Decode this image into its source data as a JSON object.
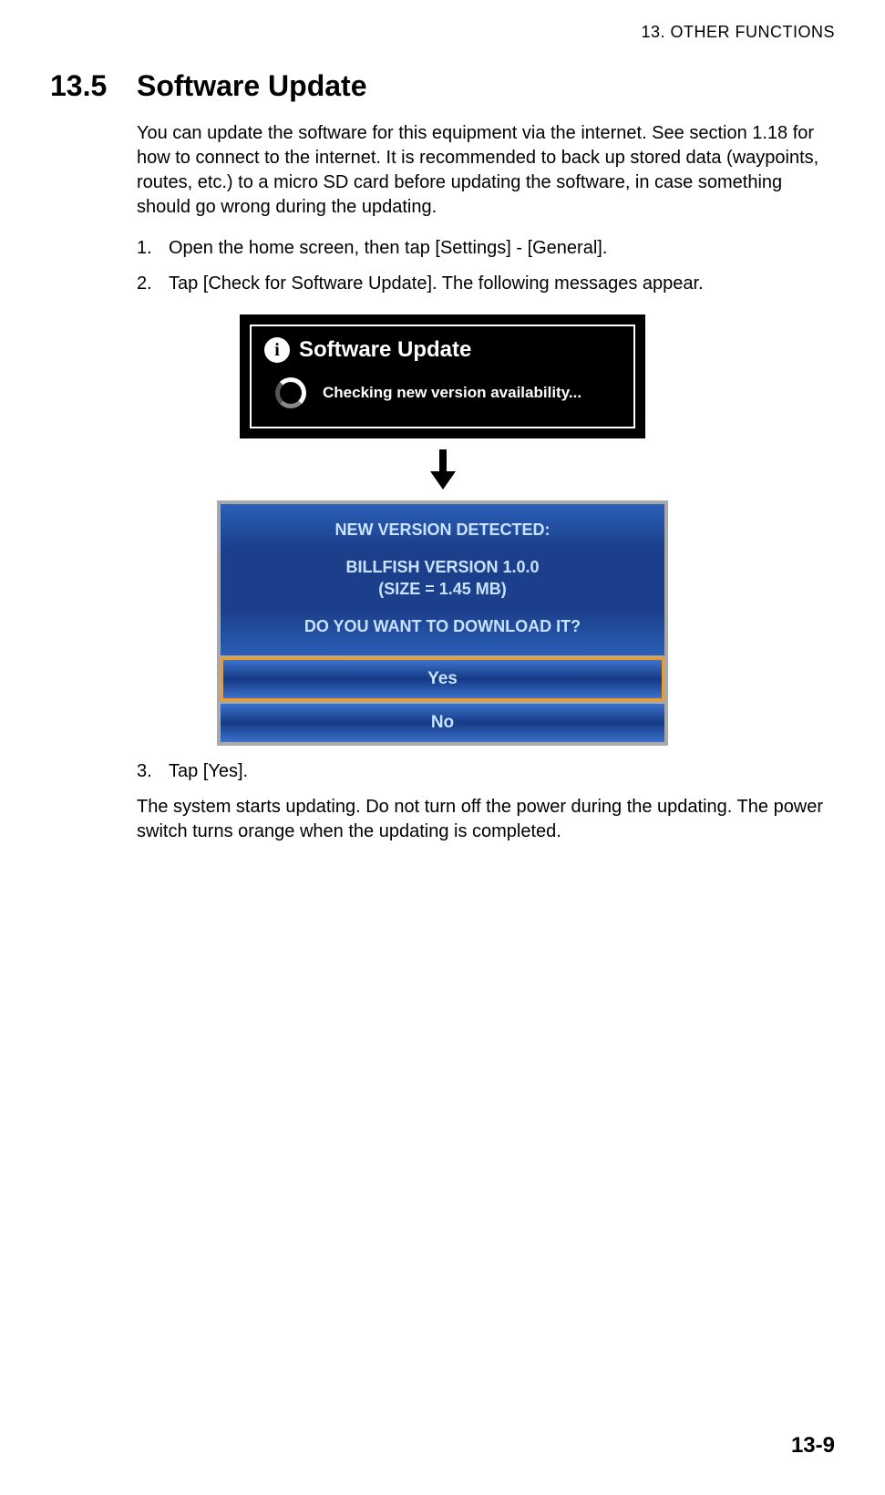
{
  "chapter_header": "13.  OTHER FUNCTIONS",
  "section": {
    "number": "13.5",
    "title": "Software Update"
  },
  "intro": "You can update the software for this equipment via the internet. See section 1.18 for how to connect to the internet. It is recommended to back up stored data (waypoints, routes, etc.) to a micro SD card before updating the software, in case something should go wrong during the updating.",
  "steps": [
    {
      "n": "1.",
      "text": "Open the home screen, then tap [Settings] - [General]."
    },
    {
      "n": "2.",
      "text": "Tap [Check for Software Update]. The following messages appear."
    },
    {
      "n": "3.",
      "text": "Tap [Yes]."
    }
  ],
  "dialog_black": {
    "info_glyph": "i",
    "title": "Software Update",
    "status": "Checking new version availability..."
  },
  "dialog_blue": {
    "line1": "NEW VERSION DETECTED:",
    "line2": "BILLFISH VERSION 1.0.0",
    "line3": "(SIZE = 1.45 MB)",
    "line4": "DO YOU WANT TO DOWNLOAD IT?",
    "yes": "Yes",
    "no": "No"
  },
  "outro": "The system starts updating. Do not turn off the power during the updating. The power switch turns orange when the updating is completed.",
  "page_number": "13-9"
}
